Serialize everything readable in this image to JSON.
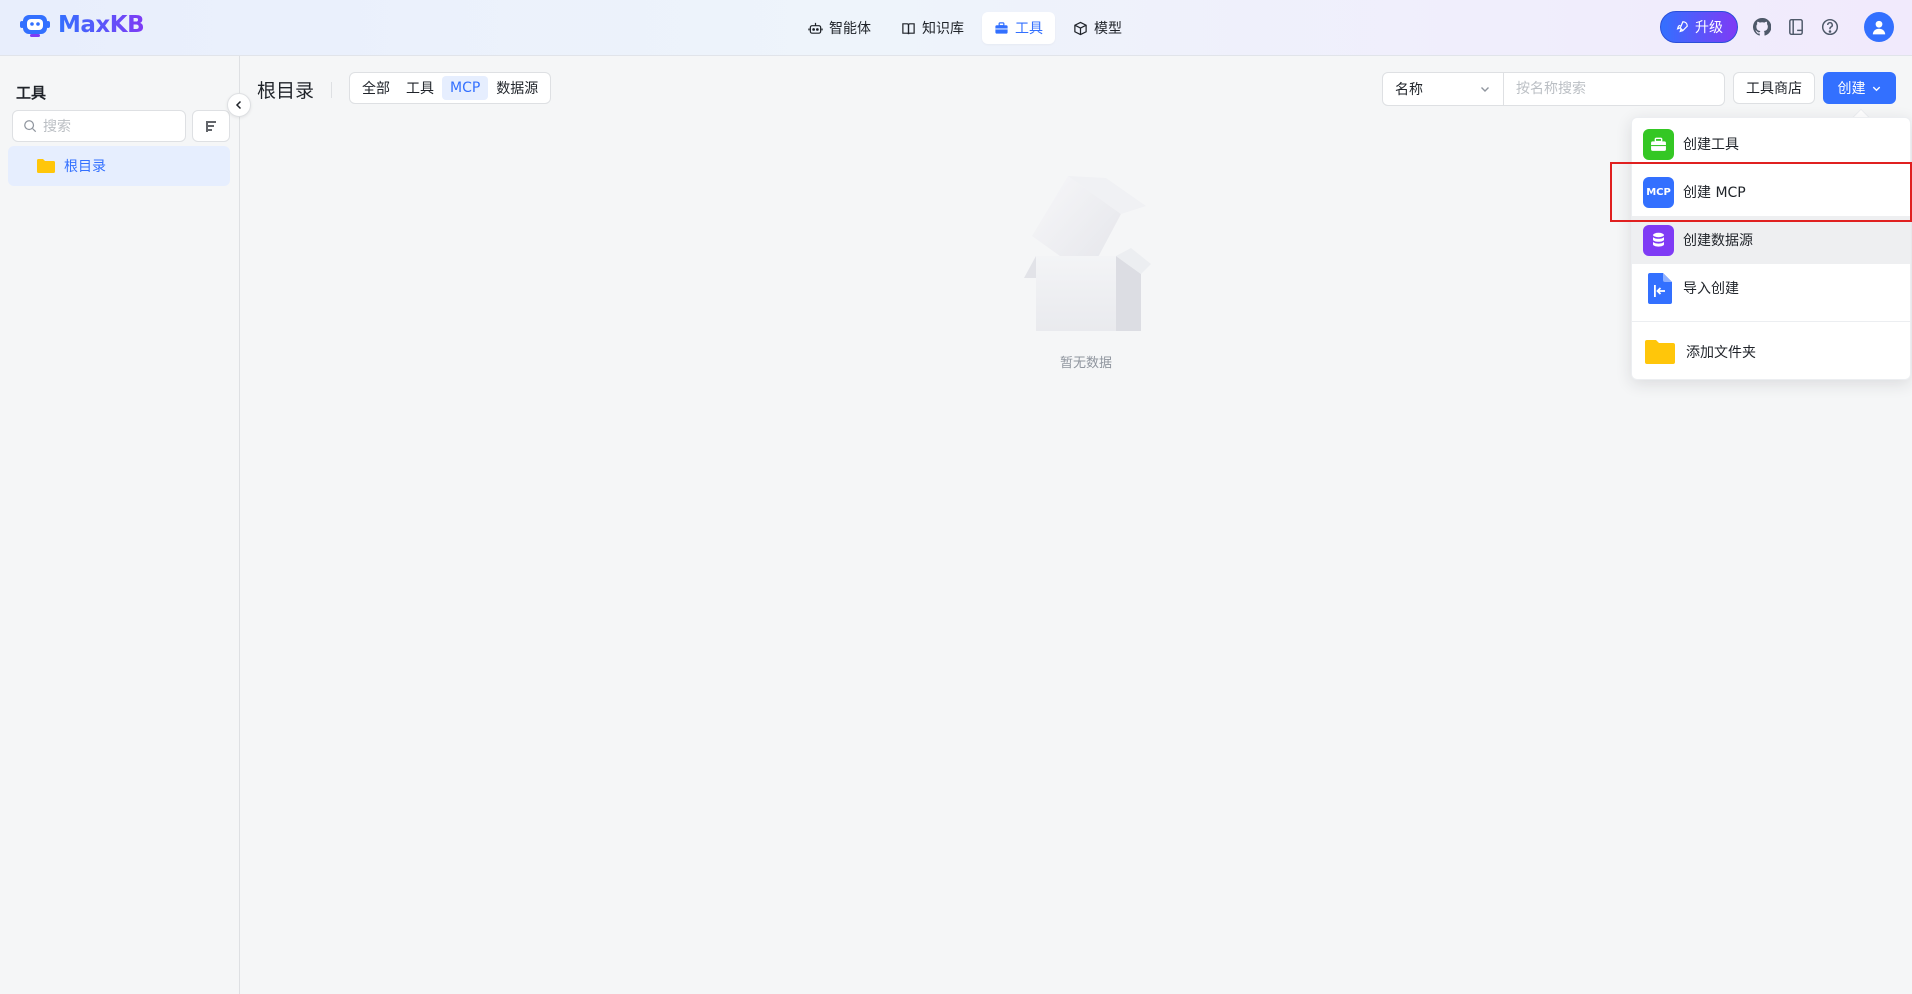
{
  "app": {
    "name": "MaxKB"
  },
  "nav": {
    "items": [
      {
        "label": "智能体",
        "icon": "robot-icon"
      },
      {
        "label": "知识库",
        "icon": "book-icon"
      },
      {
        "label": "工具",
        "icon": "toolbox-icon"
      },
      {
        "label": "模型",
        "icon": "cube-icon"
      }
    ],
    "active": "工具"
  },
  "header": {
    "upgrade_label": "升级"
  },
  "sidebar": {
    "title": "工具",
    "search_placeholder": "搜索",
    "tree": [
      {
        "label": "根目录",
        "icon": "folder-icon"
      }
    ]
  },
  "main": {
    "title": "根目录",
    "filters": [
      "全部",
      "工具",
      "MCP",
      "数据源"
    ],
    "active_filter": "MCP",
    "search_field": "名称",
    "search_placeholder": "按名称搜索",
    "store_label": "工具商店",
    "create_label": "创建",
    "empty_text": "暂无数据"
  },
  "dropdown": {
    "items": [
      {
        "label": "创建工具",
        "icon": "toolbox-icon",
        "color": "#34c724"
      },
      {
        "label": "创建 MCP",
        "icon": "mcp-icon",
        "icon_text": "MCP",
        "color": "#3370ff"
      },
      {
        "label": "创建数据源",
        "icon": "database-icon",
        "color": "#7f3bf5"
      },
      {
        "label": "导入创建",
        "icon": "import-file-icon",
        "color": "#3370ff"
      },
      {
        "label": "添加文件夹",
        "icon": "folder-icon",
        "color": "#ffc60a"
      }
    ]
  },
  "colors": {
    "primary": "#3370ff",
    "highlight": "#e02020"
  }
}
